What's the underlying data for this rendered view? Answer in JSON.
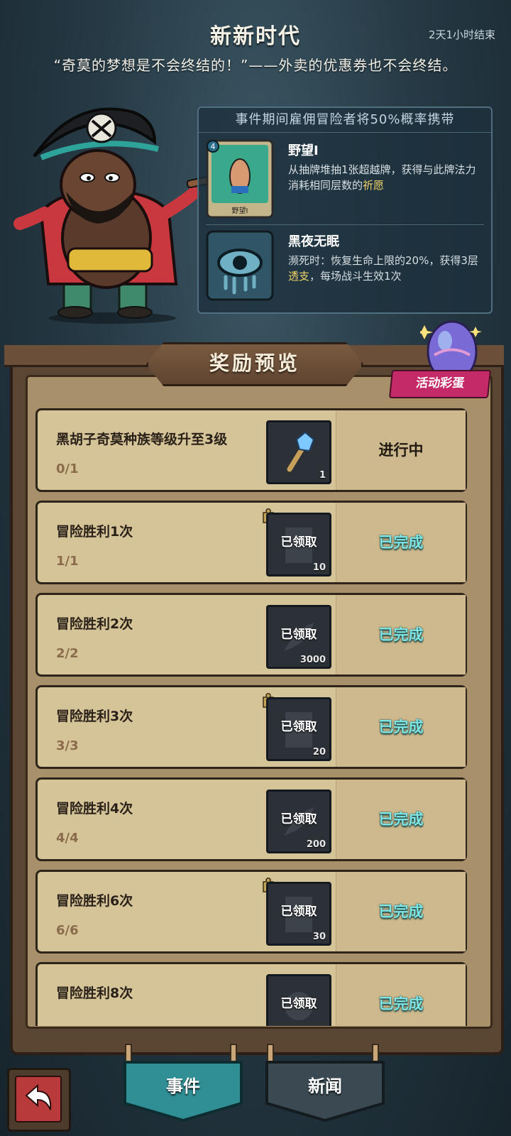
{
  "header": {
    "title": "新新时代",
    "countdown": "2天1小时结束",
    "quote": "“奇莫的梦想是不会终结的！”——外卖的优惠券也不会终结。"
  },
  "bonus": {
    "heading": "事件期间雇佣冒险者将50%概率携带",
    "items": [
      {
        "name": "野望Ⅰ",
        "cost": "4",
        "card_caption": "野望Ⅰ",
        "desc_before": "从抽牌堆抽1张超越牌，获得与此牌法力消耗相同层数的",
        "desc_highlight": "祈愿",
        "desc_after": ""
      },
      {
        "name": "黑夜无眠",
        "desc_before": "濒死时：恢复生命上限的20%，获得3层",
        "desc_highlight": "透支",
        "desc_after": "，每场战斗生效1次"
      }
    ]
  },
  "board": {
    "title": "奖励预览",
    "egg_label": "活动彩蛋"
  },
  "tasks": [
    {
      "condition": "黑胡子奇莫种族等级升至3级",
      "progress": "0/1",
      "reward_qty": "1",
      "claimed": "",
      "status": "进行中",
      "state": "going",
      "has_puzzle": false,
      "reward_icon": "gem-wand-icon"
    },
    {
      "condition": "冒险胜利1次",
      "progress": "1/1",
      "reward_qty": "10",
      "claimed": "已领取",
      "status": "已完成",
      "state": "done",
      "has_puzzle": true,
      "reward_icon": "card-pack-icon"
    },
    {
      "condition": "冒险胜利2次",
      "progress": "2/2",
      "reward_qty": "3000",
      "claimed": "已领取",
      "status": "已完成",
      "state": "done",
      "has_puzzle": false,
      "reward_icon": "carrot-icon"
    },
    {
      "condition": "冒险胜利3次",
      "progress": "3/3",
      "reward_qty": "20",
      "claimed": "已领取",
      "status": "已完成",
      "state": "done",
      "has_puzzle": true,
      "reward_icon": "card-pack-icon"
    },
    {
      "condition": "冒险胜利4次",
      "progress": "4/4",
      "reward_qty": "200",
      "claimed": "已领取",
      "status": "已完成",
      "state": "done",
      "has_puzzle": false,
      "reward_icon": "carrot-icon"
    },
    {
      "condition": "冒险胜利6次",
      "progress": "6/6",
      "reward_qty": "30",
      "claimed": "已领取",
      "status": "已完成",
      "state": "done",
      "has_puzzle": true,
      "reward_icon": "card-pack-icon"
    },
    {
      "condition": "冒险胜利8次",
      "progress": "",
      "reward_qty": "",
      "claimed": "已领取",
      "status": "已完成",
      "state": "done",
      "has_puzzle": false,
      "reward_icon": "gear-item-icon"
    }
  ],
  "nav": {
    "tab_event": "事件",
    "tab_news": "新闻"
  },
  "colors": {
    "accent_done": "#7fe6e6",
    "egg_tag": "#c32a67",
    "tab_active": "#2f8f95",
    "tab_inactive": "#3b4a52"
  }
}
